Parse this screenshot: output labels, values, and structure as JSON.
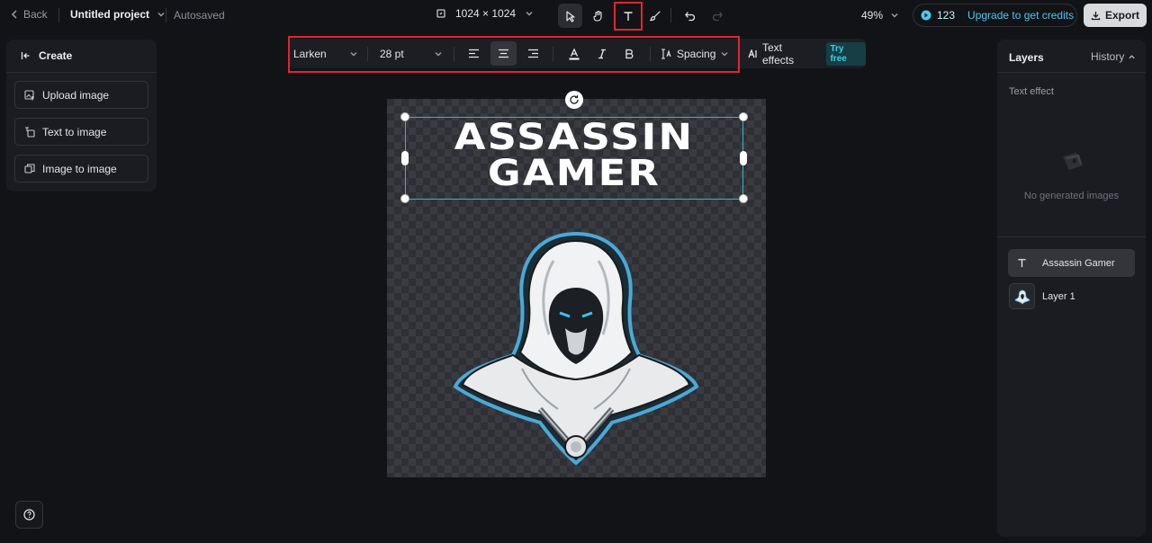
{
  "topbar": {
    "back_label": "Back",
    "project_name": "Untitled project",
    "autosaved": "Autosaved",
    "dimensions": "1024 × 1024",
    "zoom": "49%",
    "credits": "123",
    "upgrade": "Upgrade to get credits",
    "export": "Export"
  },
  "left_panel": {
    "title": "Create",
    "buttons": [
      {
        "label": "Upload image"
      },
      {
        "label": "Text to image"
      },
      {
        "label": "Image to image"
      }
    ]
  },
  "text_toolbar": {
    "font": "Larken",
    "size": "28 pt",
    "spacing": "Spacing",
    "text_effects": "Text effects",
    "try_free": "Try free"
  },
  "canvas": {
    "text_line1": "ASSASSIN",
    "text_line2": "GAMER"
  },
  "right_panel": {
    "title": "Layers",
    "history": "History",
    "section": "Text effect",
    "empty": "No generated images",
    "layers": [
      {
        "label": "Assassin Gamer"
      },
      {
        "label": "Layer 1"
      }
    ]
  },
  "colors": {
    "background": "#121317",
    "panel": "#1b1c21",
    "accent": "#2fb8c4",
    "highlight_box": "#e0262d",
    "upgrade_text": "#4fc8e8"
  }
}
